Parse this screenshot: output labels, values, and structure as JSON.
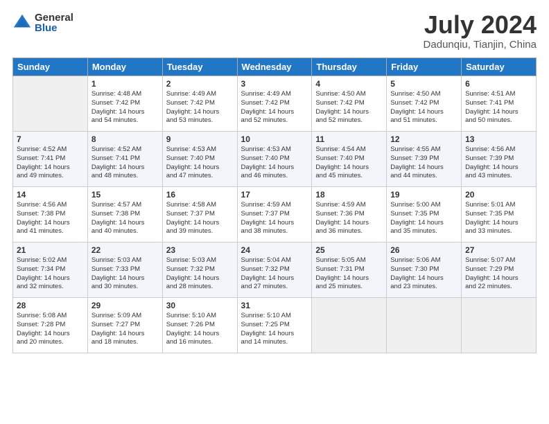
{
  "header": {
    "logo": {
      "general": "General",
      "blue": "Blue"
    },
    "title": "July 2024",
    "location": "Dadunqiu, Tianjin, China"
  },
  "days": [
    "Sunday",
    "Monday",
    "Tuesday",
    "Wednesday",
    "Thursday",
    "Friday",
    "Saturday"
  ],
  "weeks": [
    [
      {
        "date": "",
        "sunrise": "",
        "sunset": "",
        "daylight": ""
      },
      {
        "date": "1",
        "sunrise": "Sunrise: 4:48 AM",
        "sunset": "Sunset: 7:42 PM",
        "daylight": "Daylight: 14 hours and 54 minutes."
      },
      {
        "date": "2",
        "sunrise": "Sunrise: 4:49 AM",
        "sunset": "Sunset: 7:42 PM",
        "daylight": "Daylight: 14 hours and 53 minutes."
      },
      {
        "date": "3",
        "sunrise": "Sunrise: 4:49 AM",
        "sunset": "Sunset: 7:42 PM",
        "daylight": "Daylight: 14 hours and 52 minutes."
      },
      {
        "date": "4",
        "sunrise": "Sunrise: 4:50 AM",
        "sunset": "Sunset: 7:42 PM",
        "daylight": "Daylight: 14 hours and 52 minutes."
      },
      {
        "date": "5",
        "sunrise": "Sunrise: 4:50 AM",
        "sunset": "Sunset: 7:42 PM",
        "daylight": "Daylight: 14 hours and 51 minutes."
      },
      {
        "date": "6",
        "sunrise": "Sunrise: 4:51 AM",
        "sunset": "Sunset: 7:41 PM",
        "daylight": "Daylight: 14 hours and 50 minutes."
      }
    ],
    [
      {
        "date": "7",
        "sunrise": "Sunrise: 4:52 AM",
        "sunset": "Sunset: 7:41 PM",
        "daylight": "Daylight: 14 hours and 49 minutes."
      },
      {
        "date": "8",
        "sunrise": "Sunrise: 4:52 AM",
        "sunset": "Sunset: 7:41 PM",
        "daylight": "Daylight: 14 hours and 48 minutes."
      },
      {
        "date": "9",
        "sunrise": "Sunrise: 4:53 AM",
        "sunset": "Sunset: 7:40 PM",
        "daylight": "Daylight: 14 hours and 47 minutes."
      },
      {
        "date": "10",
        "sunrise": "Sunrise: 4:53 AM",
        "sunset": "Sunset: 7:40 PM",
        "daylight": "Daylight: 14 hours and 46 minutes."
      },
      {
        "date": "11",
        "sunrise": "Sunrise: 4:54 AM",
        "sunset": "Sunset: 7:40 PM",
        "daylight": "Daylight: 14 hours and 45 minutes."
      },
      {
        "date": "12",
        "sunrise": "Sunrise: 4:55 AM",
        "sunset": "Sunset: 7:39 PM",
        "daylight": "Daylight: 14 hours and 44 minutes."
      },
      {
        "date": "13",
        "sunrise": "Sunrise: 4:56 AM",
        "sunset": "Sunset: 7:39 PM",
        "daylight": "Daylight: 14 hours and 43 minutes."
      }
    ],
    [
      {
        "date": "14",
        "sunrise": "Sunrise: 4:56 AM",
        "sunset": "Sunset: 7:38 PM",
        "daylight": "Daylight: 14 hours and 41 minutes."
      },
      {
        "date": "15",
        "sunrise": "Sunrise: 4:57 AM",
        "sunset": "Sunset: 7:38 PM",
        "daylight": "Daylight: 14 hours and 40 minutes."
      },
      {
        "date": "16",
        "sunrise": "Sunrise: 4:58 AM",
        "sunset": "Sunset: 7:37 PM",
        "daylight": "Daylight: 14 hours and 39 minutes."
      },
      {
        "date": "17",
        "sunrise": "Sunrise: 4:59 AM",
        "sunset": "Sunset: 7:37 PM",
        "daylight": "Daylight: 14 hours and 38 minutes."
      },
      {
        "date": "18",
        "sunrise": "Sunrise: 4:59 AM",
        "sunset": "Sunset: 7:36 PM",
        "daylight": "Daylight: 14 hours and 36 minutes."
      },
      {
        "date": "19",
        "sunrise": "Sunrise: 5:00 AM",
        "sunset": "Sunset: 7:35 PM",
        "daylight": "Daylight: 14 hours and 35 minutes."
      },
      {
        "date": "20",
        "sunrise": "Sunrise: 5:01 AM",
        "sunset": "Sunset: 7:35 PM",
        "daylight": "Daylight: 14 hours and 33 minutes."
      }
    ],
    [
      {
        "date": "21",
        "sunrise": "Sunrise: 5:02 AM",
        "sunset": "Sunset: 7:34 PM",
        "daylight": "Daylight: 14 hours and 32 minutes."
      },
      {
        "date": "22",
        "sunrise": "Sunrise: 5:03 AM",
        "sunset": "Sunset: 7:33 PM",
        "daylight": "Daylight: 14 hours and 30 minutes."
      },
      {
        "date": "23",
        "sunrise": "Sunrise: 5:03 AM",
        "sunset": "Sunset: 7:32 PM",
        "daylight": "Daylight: 14 hours and 28 minutes."
      },
      {
        "date": "24",
        "sunrise": "Sunrise: 5:04 AM",
        "sunset": "Sunset: 7:32 PM",
        "daylight": "Daylight: 14 hours and 27 minutes."
      },
      {
        "date": "25",
        "sunrise": "Sunrise: 5:05 AM",
        "sunset": "Sunset: 7:31 PM",
        "daylight": "Daylight: 14 hours and 25 minutes."
      },
      {
        "date": "26",
        "sunrise": "Sunrise: 5:06 AM",
        "sunset": "Sunset: 7:30 PM",
        "daylight": "Daylight: 14 hours and 23 minutes."
      },
      {
        "date": "27",
        "sunrise": "Sunrise: 5:07 AM",
        "sunset": "Sunset: 7:29 PM",
        "daylight": "Daylight: 14 hours and 22 minutes."
      }
    ],
    [
      {
        "date": "28",
        "sunrise": "Sunrise: 5:08 AM",
        "sunset": "Sunset: 7:28 PM",
        "daylight": "Daylight: 14 hours and 20 minutes."
      },
      {
        "date": "29",
        "sunrise": "Sunrise: 5:09 AM",
        "sunset": "Sunset: 7:27 PM",
        "daylight": "Daylight: 14 hours and 18 minutes."
      },
      {
        "date": "30",
        "sunrise": "Sunrise: 5:10 AM",
        "sunset": "Sunset: 7:26 PM",
        "daylight": "Daylight: 14 hours and 16 minutes."
      },
      {
        "date": "31",
        "sunrise": "Sunrise: 5:10 AM",
        "sunset": "Sunset: 7:25 PM",
        "daylight": "Daylight: 14 hours and 14 minutes."
      },
      {
        "date": "",
        "sunrise": "",
        "sunset": "",
        "daylight": ""
      },
      {
        "date": "",
        "sunrise": "",
        "sunset": "",
        "daylight": ""
      },
      {
        "date": "",
        "sunrise": "",
        "sunset": "",
        "daylight": ""
      }
    ]
  ]
}
